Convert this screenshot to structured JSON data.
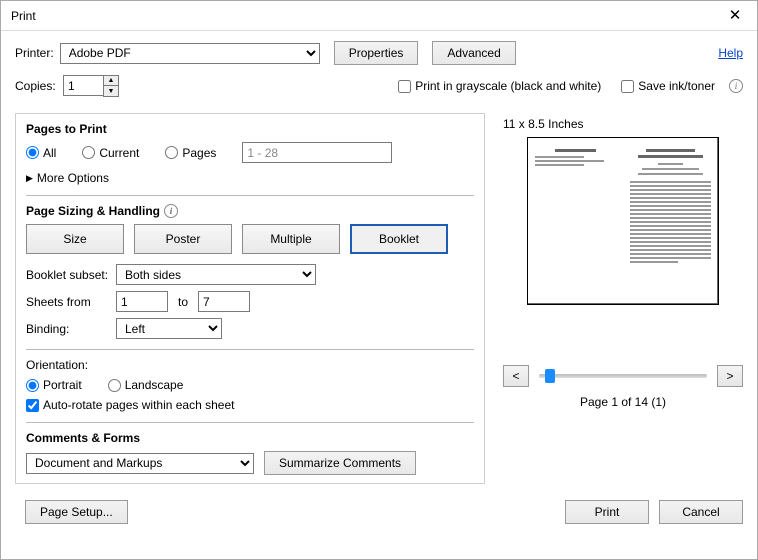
{
  "window": {
    "title": "Print"
  },
  "header": {
    "printer_label": "Printer:",
    "printer_value": "Adobe PDF",
    "properties": "Properties",
    "advanced": "Advanced",
    "help": "Help",
    "copies_label": "Copies:",
    "copies_value": "1",
    "grayscale": "Print in grayscale (black and white)",
    "save_ink": "Save ink/toner"
  },
  "pages_to_print": {
    "title": "Pages to Print",
    "all": "All",
    "current": "Current",
    "pages": "Pages",
    "pages_range": "1 - 28",
    "more_options": "More Options"
  },
  "sizing": {
    "title": "Page Sizing & Handling",
    "size": "Size",
    "poster": "Poster",
    "multiple": "Multiple",
    "booklet": "Booklet",
    "subset_label": "Booklet subset:",
    "subset_value": "Both sides",
    "sheets_from_label": "Sheets from",
    "sheets_from": "1",
    "sheets_to_label": "to",
    "sheets_to": "7",
    "binding_label": "Binding:",
    "binding_value": "Left"
  },
  "orientation": {
    "title": "Orientation:",
    "portrait": "Portrait",
    "landscape": "Landscape",
    "auto_rotate": "Auto-rotate pages within each sheet"
  },
  "comments": {
    "title": "Comments & Forms",
    "value": "Document and Markups",
    "summarize": "Summarize Comments"
  },
  "preview": {
    "dimensions": "11 x 8.5 Inches",
    "prev": "<",
    "next": ">",
    "page_indicator": "Page 1 of 14 (1)"
  },
  "footer": {
    "page_setup": "Page Setup...",
    "print": "Print",
    "cancel": "Cancel"
  }
}
